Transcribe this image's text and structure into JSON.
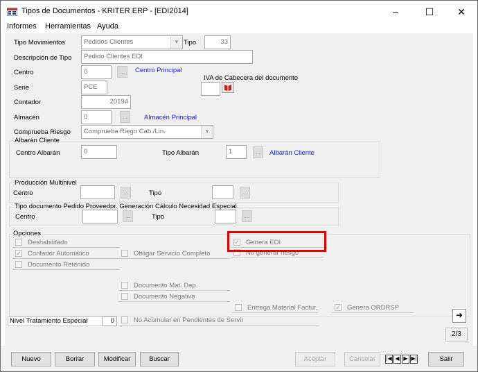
{
  "window": {
    "title": "Tipos de Documentos - KRITER ERP - [EDI2014]",
    "minimize": "–",
    "maximize": "☐",
    "close": "✕"
  },
  "menu": [
    "Informes",
    "Herramientas",
    "Ayuda"
  ],
  "form": {
    "tipo_movimientos": {
      "label": "Tipo Movimientos",
      "value": "Pedidos Clientes"
    },
    "tipo": {
      "label": "Tipo",
      "value": "33"
    },
    "descripcion": {
      "label": "Descripción de Tipo",
      "value": "Pedido Clientes EDI"
    },
    "centro": {
      "label": "Centro",
      "value": "0",
      "link": "Centro Principal"
    },
    "iva": {
      "label": "IVA de Cabecera del documento"
    },
    "serie": {
      "label": "Serie",
      "value": "PCE"
    },
    "contador": {
      "label": "Contador",
      "value": "20194"
    },
    "almacen": {
      "label": "Almacén",
      "value": "0",
      "link": "Almacén Principal"
    },
    "comprueba_riesgo": {
      "label": "Comprueba Riesgo",
      "value": "Comprueba Riego Cab./Lin."
    }
  },
  "albaran": {
    "title": "Albarán Cliente",
    "centro_label": "Centro Albarán",
    "centro_value": "0",
    "tipo_label": "Tipo Albarán",
    "tipo_value": "1",
    "tipo_link": "Albarán Cliente"
  },
  "produccion": {
    "title": "Producción Multinivel",
    "centro_label": "Centro",
    "tipo_label": "Tipo"
  },
  "pedido_proveedor": {
    "title": "Tipo documento Pedido Proveedor. Generación Cálculo Necesidad Especial.",
    "centro_label": "Centro",
    "tipo_label": "Tipo"
  },
  "opciones": {
    "title": "Opciones",
    "deshabilitado": "Deshabilitado",
    "contador_automatico": "Contador Automático",
    "documento_retenido": "Documento Retenido",
    "obligar_servicio": "Obligar Servicio Completo",
    "genera_edi": "Genera EDI",
    "no_generar_riesgo": "No generar riesgo",
    "documento_mat_dep": "Documento Mat. Dep.",
    "documento_negativo": "Documento Negativo",
    "entrega_material": "Entrega Material Factur.",
    "genera_ordrsp": "Genera ORDRSP",
    "no_acumular": "No Acumular en Pendientes de Servir"
  },
  "nivel_tratamiento": {
    "label": "Nivel Tratamiento Especial",
    "value": "0"
  },
  "page_indicator": "2/3",
  "buttons": {
    "nuevo": "Nuevo",
    "borrar": "Borrar",
    "modificar": "Modificar",
    "buscar": "Buscar",
    "aceptar": "Aceptar",
    "cancelar": "Cancelar",
    "salir": "Salir"
  },
  "icons": {
    "app": "app-icon",
    "arrow_right": "arrow-right-icon",
    "nav_first": "nav-first-icon",
    "nav_prev": "nav-prev-icon",
    "nav_next": "nav-next-icon",
    "nav_last": "nav-last-icon"
  },
  "colors": {
    "highlight_border": "#e00000",
    "link": "#1a1adb"
  }
}
